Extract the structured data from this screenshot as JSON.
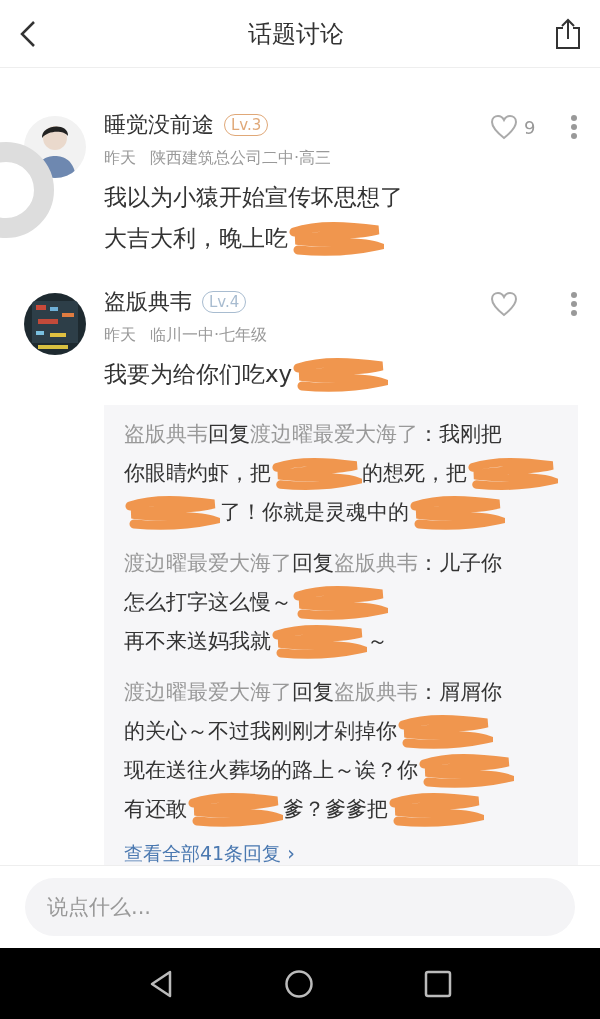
{
  "header": {
    "title": "话题讨论"
  },
  "comments": [
    {
      "avatar": {
        "kind": "picture"
      },
      "name": "睡觉没前途",
      "level": "Lv.3",
      "color": "#e0a878",
      "time": "昨天",
      "school": "陕西建筑总公司二中·高三",
      "likes": "9",
      "lines": [
        [
          {
            "kind": "text",
            "text": "我以为小猿开始宣传坏思想了"
          }
        ],
        [
          {
            "kind": "text",
            "text": "大吉大利，晚上吃"
          },
          {
            "kind": "scribble"
          }
        ]
      ]
    },
    {
      "avatar": {
        "kind": "picture"
      },
      "name": "盗版典韦",
      "level": "Lv.4",
      "color": "#a8bcd0",
      "time": "昨天",
      "school": "临川一中·七年级",
      "lines": [
        [
          {
            "kind": "text",
            "text": "我要为给你们吃xy"
          },
          {
            "kind": "scribble"
          }
        ]
      ],
      "replies": [
        {
          "from": "盗版典韦",
          "verb": "回复",
          "to": "渡边曜最爱大海了",
          "lines": [
            [
              {
                "kind": "text",
                "text": "：我刚把"
              }
            ],
            [
              {
                "kind": "text",
                "text": "你眼睛灼虾，把"
              },
              {
                "kind": "scribble"
              },
              {
                "kind": "text",
                "text": "的想死，把"
              },
              {
                "kind": "scribble"
              }
            ],
            [
              {
                "kind": "scribble"
              },
              {
                "kind": "text",
                "text": "了！你就是灵魂中的"
              },
              {
                "kind": "scribble"
              }
            ]
          ]
        },
        {
          "from": "渡边曜最爱大海了",
          "verb": "回复",
          "to": "盗版典韦",
          "lines": [
            [
              {
                "kind": "text",
                "text": "：儿子你"
              }
            ],
            [
              {
                "kind": "text",
                "text": "怎么打字这么慢～"
              },
              {
                "kind": "scribble"
              }
            ],
            [
              {
                "kind": "text",
                "text": "再不来送妈我就"
              },
              {
                "kind": "scribble"
              },
              {
                "kind": "text",
                "text": "～"
              }
            ]
          ]
        },
        {
          "from": "渡边曜最爱大海了",
          "verb": "回复",
          "to": "盗版典韦",
          "lines": [
            [
              {
                "kind": "text",
                "text": "：屑屑你"
              }
            ],
            [
              {
                "kind": "text",
                "text": "的关心～不过我刚刚才剁掉你"
              },
              {
                "kind": "scribble"
              }
            ],
            [
              {
                "kind": "text",
                "text": "现在送往火葬场的路上～诶？你"
              },
              {
                "kind": "scribble"
              }
            ],
            [
              {
                "kind": "text",
                "text": "有还敢"
              },
              {
                "kind": "scribble"
              },
              {
                "kind": "text",
                "text": "爹？爹爹把"
              },
              {
                "kind": "scribble"
              }
            ]
          ]
        }
      ],
      "more_link": "查看全部41条回复 ›"
    }
  ],
  "input": {
    "placeholder": "说点什么..."
  }
}
